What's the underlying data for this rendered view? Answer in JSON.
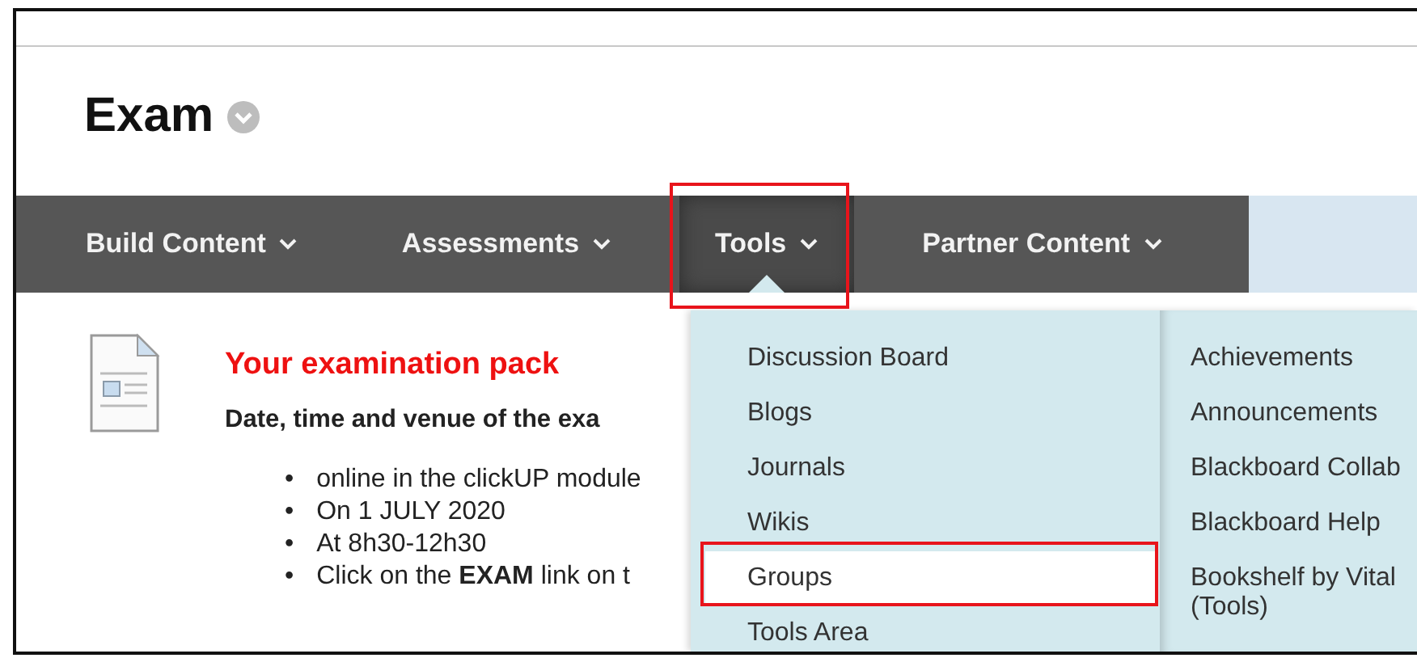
{
  "page_title": "Exam",
  "nav": [
    {
      "label": "Build Content",
      "selected": false,
      "highlighted": false
    },
    {
      "label": "Assessments",
      "selected": false,
      "highlighted": false
    },
    {
      "label": "Tools",
      "selected": true,
      "highlighted": true
    },
    {
      "label": "Partner Content",
      "selected": false,
      "highlighted": false
    }
  ],
  "content": {
    "bullet_marker": "•",
    "heading": "Your examination pack",
    "intro": "Date, time and venue of the exa",
    "bullets": [
      "online in the clickUP module",
      "On 1 JULY 2020",
      "At 8h30-12h30",
      "Click on the **EXAM** link on t"
    ]
  },
  "tools_menu": {
    "columns": [
      [
        {
          "label": "Discussion Board",
          "selected": false,
          "highlighted": false
        },
        {
          "label": "Blogs",
          "selected": false,
          "highlighted": false
        },
        {
          "label": "Journals",
          "selected": false,
          "highlighted": false
        },
        {
          "label": "Wikis",
          "selected": false,
          "highlighted": false
        },
        {
          "label": "Groups",
          "selected": true,
          "highlighted": true
        },
        {
          "label": "Tools Area",
          "selected": false,
          "highlighted": false
        }
      ],
      [
        {
          "label": "Achievements",
          "selected": false,
          "highlighted": false
        },
        {
          "label": "Announcements",
          "selected": false,
          "highlighted": false
        },
        {
          "label": "Blackboard Collab",
          "selected": false,
          "highlighted": false
        },
        {
          "label": "Blackboard Help",
          "selected": false,
          "highlighted": false
        },
        {
          "label": "Bookshelf by Vital (Tools)",
          "selected": false,
          "highlighted": false
        }
      ]
    ]
  }
}
